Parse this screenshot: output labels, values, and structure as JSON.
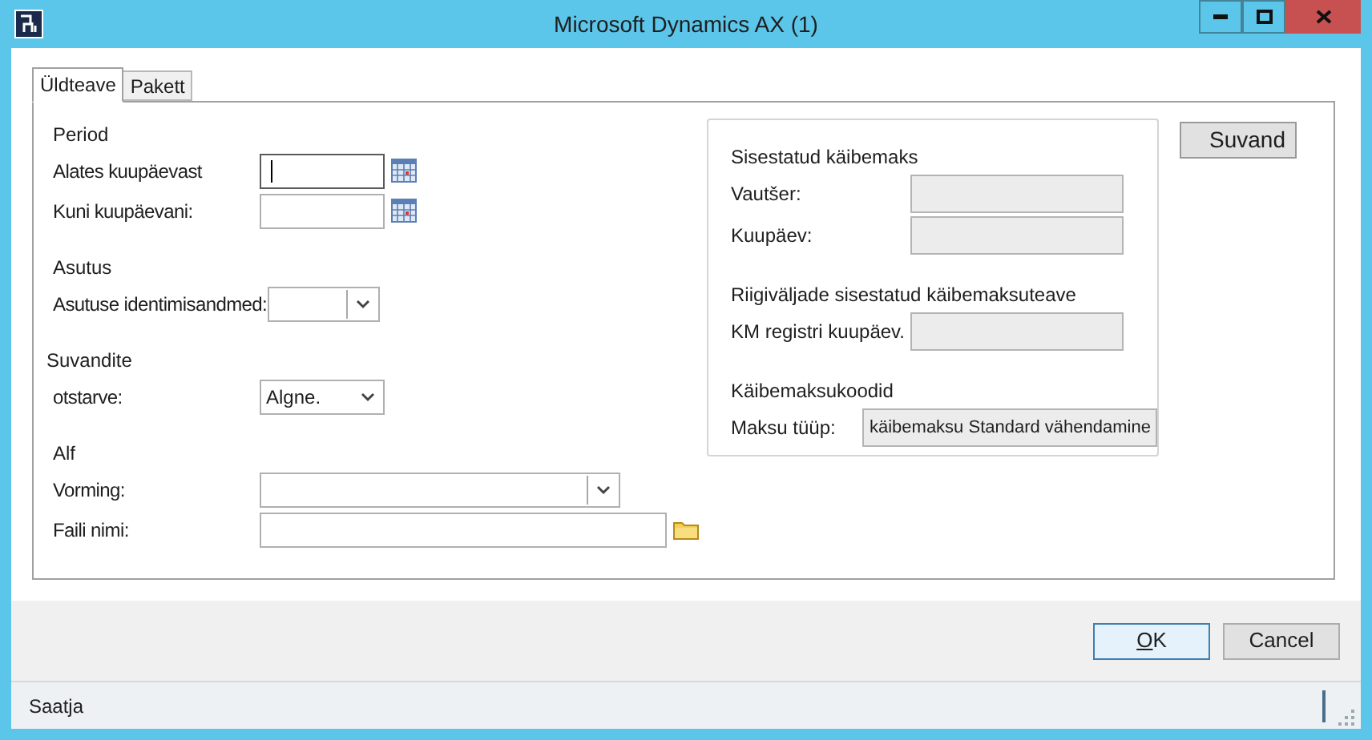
{
  "window": {
    "title": "Microsoft Dynamics AX (1)"
  },
  "tabs": [
    {
      "label": "Üldteave",
      "selected": true
    },
    {
      "label": "Pakett",
      "selected": false
    }
  ],
  "sections": [
    {
      "title": "Period",
      "fields": [
        {
          "label": "Alates kuupäevast",
          "kind": "date",
          "focused": true,
          "disabled": false
        },
        {
          "label": "Kuni kuupäevani:",
          "kind": "date",
          "focused": false,
          "disabled": false
        }
      ]
    },
    {
      "title": "Asutus",
      "fields": [
        {
          "label": "Asutuse identimisandmed:",
          "kind": "combo",
          "focused": false,
          "disabled": false
        }
      ]
    },
    {
      "title": "Suvandite",
      "fields": [
        {
          "label": "otstarve:",
          "kind": "combo",
          "value": "Algne.",
          "focused": false,
          "disabled": false
        }
      ]
    },
    {
      "title": "Alf",
      "fields": [
        {
          "label": "Vorming:",
          "kind": "combo",
          "focused": false,
          "disabled": false
        },
        {
          "label": "Faili nimi:",
          "kind": "file",
          "focused": false,
          "disabled": false
        }
      ]
    }
  ],
  "group": {
    "sections": [
      {
        "title": "Sisestatud käibemaks",
        "fields": [
          {
            "label": "Vautšer:",
            "disabled": true
          },
          {
            "label": "Kuupäev:",
            "disabled": true
          }
        ]
      },
      {
        "title": "Riigiväljade sisestatud käibemaksuteave",
        "fields": [
          {
            "label": "KM registri kuupäev.",
            "disabled": true
          }
        ]
      },
      {
        "title": "Käibemaksukoodid",
        "fields": [
          {
            "label": "Maksu tüüp:",
            "value": "käibemaksu Standard vähendamine",
            "disabled": true
          }
        ]
      }
    ]
  },
  "side_button": {
    "label": "Suvand"
  },
  "footer_buttons": [
    {
      "access_key": "O",
      "label_rest": "K",
      "default": true
    },
    {
      "label_rest": "Cancel",
      "default": false
    }
  ],
  "status_bar": {
    "text": "Saatja"
  }
}
